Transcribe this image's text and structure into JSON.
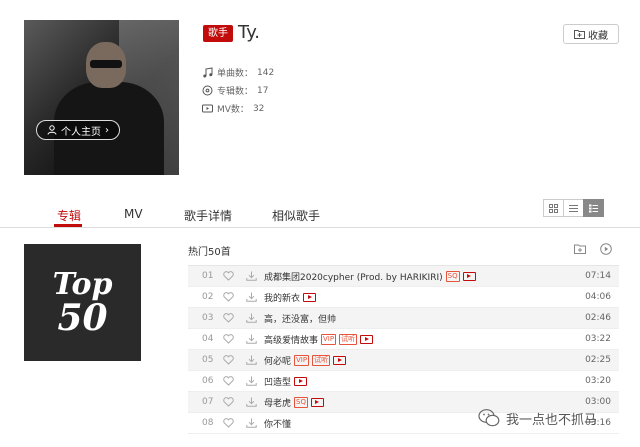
{
  "artist": {
    "name": "Ty.",
    "badge": "歌手",
    "home_button": "个人主页",
    "fav_button": "收藏",
    "stats": [
      {
        "icon": "music-note-icon",
        "label": "单曲数：",
        "value": "142"
      },
      {
        "icon": "album-icon",
        "label": "专辑数：",
        "value": "17"
      },
      {
        "icon": "mv-icon",
        "label": "MV数：",
        "value": "32"
      }
    ]
  },
  "tabs": [
    "专辑",
    "MV",
    "歌手详情",
    "相似歌手"
  ],
  "active_tab": "专辑",
  "cover": {
    "line1": "Top",
    "line2": "50"
  },
  "hot": {
    "title": "热门50首",
    "songs": [
      {
        "no": "01",
        "name": "成都集团2020cypher (Prod. by HARIKIRI)",
        "tags": [
          "SQ"
        ],
        "mv": true,
        "duration": "07:14"
      },
      {
        "no": "02",
        "name": "我的新衣",
        "tags": [],
        "mv": true,
        "duration": "04:06"
      },
      {
        "no": "03",
        "name": "高，还没富，但帅",
        "tags": [],
        "mv": false,
        "duration": "02:46"
      },
      {
        "no": "04",
        "name": "高级爱情故事",
        "tags": [
          "VIP",
          "试听"
        ],
        "mv": true,
        "duration": "03:22"
      },
      {
        "no": "05",
        "name": "何必呢",
        "tags": [
          "VIP",
          "试听"
        ],
        "mv": true,
        "duration": "02:25"
      },
      {
        "no": "06",
        "name": "凹造型",
        "tags": [],
        "mv": true,
        "duration": "03:20"
      },
      {
        "no": "07",
        "name": "母老虎",
        "tags": [
          "SQ"
        ],
        "mv": true,
        "duration": "03:00"
      },
      {
        "no": "08",
        "name": "你不懂",
        "tags": [],
        "mv": false,
        "duration": "03:16"
      }
    ]
  },
  "watermark": "我一点也不抓马",
  "colors": {
    "accent": "#c20c0c",
    "tag": "#e7543c"
  }
}
